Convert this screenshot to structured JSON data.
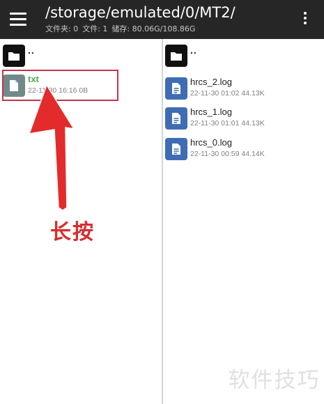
{
  "appbar": {
    "path": "/storage/emulated/0/MT2/",
    "stats": {
      "folders": "文件夹: 0",
      "files": "文件: 1",
      "storage": "储存: 80.06G/108.86G"
    },
    "menu_icon": "hamburger-menu-icon",
    "more_icon": "more-vertical-icon"
  },
  "left_pane": {
    "parent": {
      "label": "..",
      "icon": "folder-icon"
    },
    "files": [
      {
        "name": "txt",
        "meta": "22-11-30 16:16  0B",
        "icon": "document-icon",
        "name_color": "#4caf50",
        "icon_color": "#6f8a89"
      }
    ]
  },
  "right_pane": {
    "parent": {
      "label": "..",
      "icon": "folder-icon"
    },
    "files": [
      {
        "name": "hrcs_2.log",
        "meta": "22-11-30 01:02  44.13K",
        "icon": "document-icon"
      },
      {
        "name": "hrcs_1.log",
        "meta": "22-11-30 01:01  44.13K",
        "icon": "document-icon"
      },
      {
        "name": "hrcs_0.log",
        "meta": "22-11-30 00:59  44.14K",
        "icon": "document-icon"
      }
    ]
  },
  "annotation": {
    "label": "长按",
    "color": "#d62f2f"
  },
  "watermark": {
    "text": "软件技巧"
  },
  "colors": {
    "appbar_bg": "#262626",
    "doc_tile": "#3f6db3",
    "highlight_border": "#c4344b"
  }
}
